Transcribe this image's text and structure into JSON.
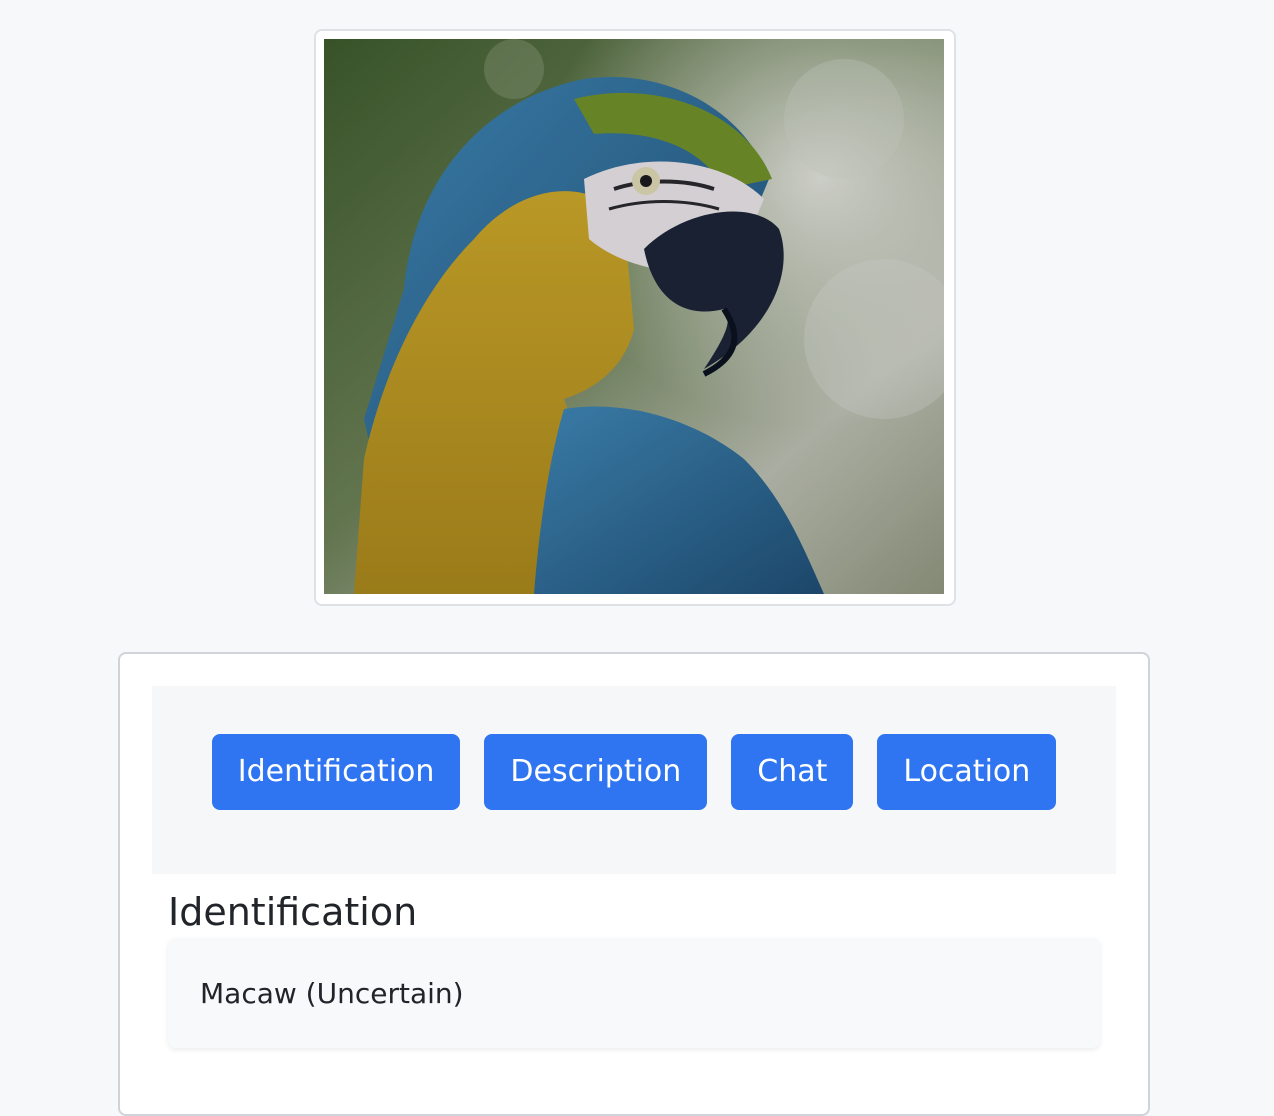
{
  "image": {
    "subject": "macaw-photo"
  },
  "tabs": [
    {
      "label": "Identification"
    },
    {
      "label": "Description"
    },
    {
      "label": "Chat"
    },
    {
      "label": "Location"
    }
  ],
  "section": {
    "title": "Identification",
    "result": "Macaw (Uncertain)"
  },
  "colors": {
    "accent": "#2f74f0",
    "background": "#f7f8fa"
  }
}
